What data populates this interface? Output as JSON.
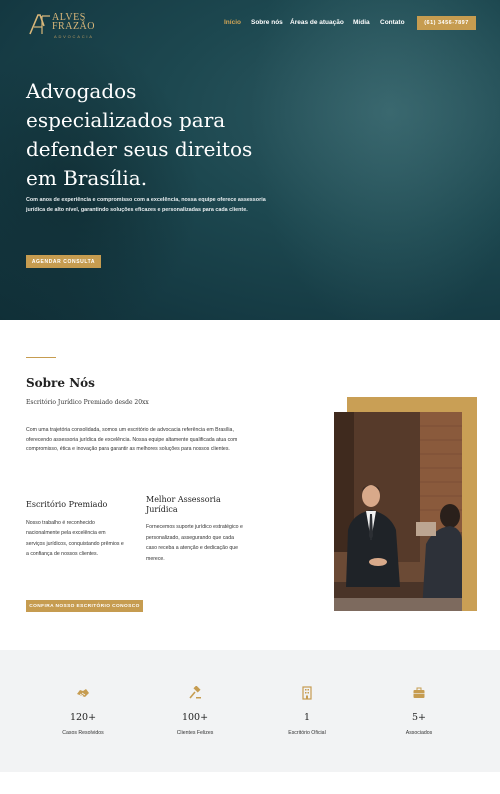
{
  "header": {
    "logo_line1": "ALVES",
    "logo_line2": "FRAZÃO",
    "logo_tagline": "ADVOCACIA",
    "nav": [
      {
        "label": "Início",
        "active": true
      },
      {
        "label": "Sobre nós",
        "active": false
      },
      {
        "label": "Áreas de atuação",
        "active": false
      },
      {
        "label": "Mídia",
        "active": false
      },
      {
        "label": "Contato",
        "active": false
      }
    ],
    "phone_button": "(61) 3456-7897"
  },
  "hero": {
    "title": "Advogados especializados para defender seus direitos em Brasília.",
    "description": "Com anos de experiência e compromisso com a excelência, nossa equipe oferece assessoria jurídica de alto nível, garantindo soluções eficazes e personalizadas para cada cliente.",
    "cta": "AGENDAR CONSULTA"
  },
  "about": {
    "title": "Sobre Nós",
    "subtitle": "Escritório Jurídico Premiado desde 20xx",
    "text": "Com uma trajetória consolidada, somos um escritório de advocacia referência em Brasília, oferecendo assessoria jurídica de excelência. Nossa equipe altamente qualificada atua com compromisso, ética e inovação para garantir as melhores soluções para nossos clientes.",
    "features": [
      {
        "title": "Escritório Premiado",
        "text": "Nosso trabalho é reconhecido nacionalmente pela excelência em serviços jurídicos, conquistando prêmios e a confiança de nossos clientes."
      },
      {
        "title": "Melhor Assessoria Jurídica",
        "text": "Fornecemos suporte jurídico estratégico e personalizado, assegurando que cada caso receba a atenção e dedicação que merece."
      }
    ],
    "cta": "CONFIRA NOSSO ESCRITÓRIO CONOSCO"
  },
  "stats": [
    {
      "icon": "handshake-icon",
      "value": "120+",
      "label": "Casos Resolvidos"
    },
    {
      "icon": "gavel-icon",
      "value": "100+",
      "label": "Clientes Felizes"
    },
    {
      "icon": "building-icon",
      "value": "1",
      "label": "Escritório Oficial"
    },
    {
      "icon": "briefcase-icon",
      "value": "5+",
      "label": "Associados"
    }
  ],
  "colors": {
    "accent": "#c69c50",
    "hero_bg": "#1d4850",
    "stats_bg": "#f2f3f4"
  }
}
